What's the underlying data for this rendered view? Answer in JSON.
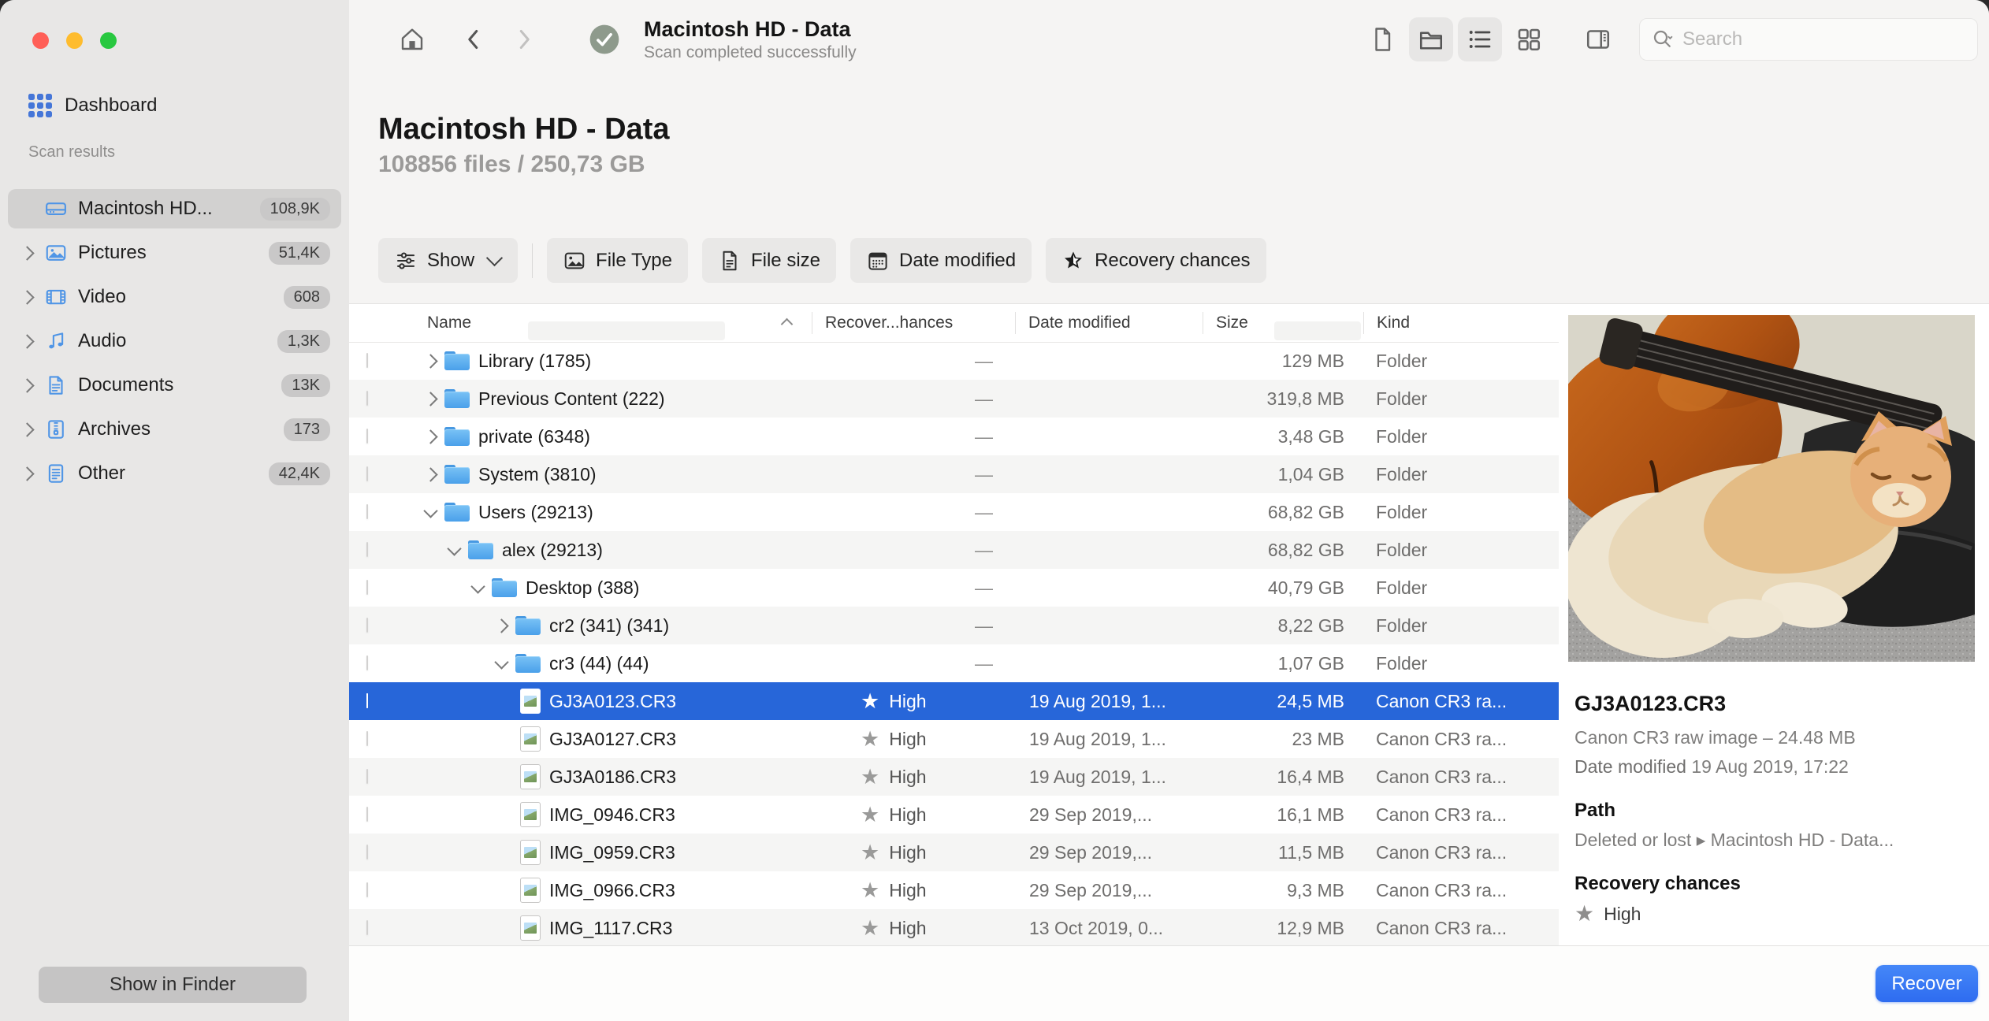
{
  "colors": {
    "accent_blue": "#3478f6",
    "selection_blue": "#2766d9",
    "folder_blue": "#4aa0ea",
    "sidebar_bg": "#e8e7e6",
    "badge_gray": "#c9c8c8",
    "traffic_red": "#ff5f57",
    "traffic_yellow": "#febc2e",
    "traffic_green": "#28c840",
    "scan_badge_green_gray": "#8e9a8c"
  },
  "icons": {
    "star_glyph": "★",
    "dash_glyph": "—"
  },
  "sidebar": {
    "dashboard_label": "Dashboard",
    "section_label": "Scan results",
    "items": [
      {
        "label": "Macintosh HD...",
        "badge": "108,9K",
        "icon": "drive",
        "selected": true,
        "chevron": false
      },
      {
        "label": "Pictures",
        "badge": "51,4K",
        "icon": "pictures",
        "selected": false,
        "chevron": true
      },
      {
        "label": "Video",
        "badge": "608",
        "icon": "video",
        "selected": false,
        "chevron": true
      },
      {
        "label": "Audio",
        "badge": "1,3K",
        "icon": "audio",
        "selected": false,
        "chevron": true
      },
      {
        "label": "Documents",
        "badge": "13K",
        "icon": "documents",
        "selected": false,
        "chevron": true
      },
      {
        "label": "Archives",
        "badge": "173",
        "icon": "archives",
        "selected": false,
        "chevron": true
      },
      {
        "label": "Other",
        "badge": "42,4K",
        "icon": "other",
        "selected": false,
        "chevron": true
      }
    ],
    "show_in_finder_label": "Show in Finder"
  },
  "toolbar": {
    "title": "Macintosh HD - Data",
    "subtitle": "Scan completed successfully",
    "search_placeholder": "Search"
  },
  "header": {
    "title": "Macintosh HD - Data",
    "stats": "108856 files / 250,73 GB"
  },
  "filters": {
    "show_label": "Show",
    "file_type_label": "File Type",
    "file_size_label": "File size",
    "date_modified_label": "Date modified",
    "recovery_chances_label": "Recovery chances"
  },
  "table": {
    "columns": {
      "name": "Name",
      "recovery": "Recover...hances",
      "date": "Date modified",
      "size": "Size",
      "kind": "Kind"
    },
    "rows": [
      {
        "type": "folder",
        "level": 1,
        "expanded": "right",
        "name": "Library (1785)",
        "recovery": "—",
        "date": "",
        "size": "129 MB",
        "kind": "Folder",
        "selected": false
      },
      {
        "type": "folder",
        "level": 1,
        "expanded": "right",
        "name": "Previous Content (222)",
        "recovery": "—",
        "date": "",
        "size": "319,8 MB",
        "kind": "Folder",
        "selected": false
      },
      {
        "type": "folder",
        "level": 1,
        "expanded": "right",
        "name": "private (6348)",
        "recovery": "—",
        "date": "",
        "size": "3,48 GB",
        "kind": "Folder",
        "selected": false
      },
      {
        "type": "folder",
        "level": 1,
        "expanded": "right",
        "name": "System (3810)",
        "recovery": "—",
        "date": "",
        "size": "1,04 GB",
        "kind": "Folder",
        "selected": false
      },
      {
        "type": "folder",
        "level": 1,
        "expanded": "down",
        "name": "Users (29213)",
        "recovery": "—",
        "date": "",
        "size": "68,82 GB",
        "kind": "Folder",
        "selected": false
      },
      {
        "type": "folder",
        "level": 2,
        "expanded": "down",
        "name": "alex (29213)",
        "recovery": "—",
        "date": "",
        "size": "68,82 GB",
        "kind": "Folder",
        "selected": false
      },
      {
        "type": "folder",
        "level": 3,
        "expanded": "down",
        "name": "Desktop (388)",
        "recovery": "—",
        "date": "",
        "size": "40,79 GB",
        "kind": "Folder",
        "selected": false
      },
      {
        "type": "folder",
        "level": 4,
        "expanded": "right",
        "name": "cr2 (341) (341)",
        "recovery": "—",
        "date": "",
        "size": "8,22 GB",
        "kind": "Folder",
        "selected": false
      },
      {
        "type": "folder",
        "level": 4,
        "expanded": "down",
        "name": "cr3 (44) (44)",
        "recovery": "—",
        "date": "",
        "size": "1,07 GB",
        "kind": "Folder",
        "selected": false
      },
      {
        "type": "file",
        "level": 5,
        "expanded": null,
        "name": "GJ3A0123.CR3",
        "recovery": "High",
        "date": "19 Aug 2019, 1...",
        "size": "24,5 MB",
        "kind": "Canon CR3 ra...",
        "selected": true
      },
      {
        "type": "file",
        "level": 5,
        "expanded": null,
        "name": "GJ3A0127.CR3",
        "recovery": "High",
        "date": "19 Aug 2019, 1...",
        "size": "23 MB",
        "kind": "Canon CR3 ra...",
        "selected": false
      },
      {
        "type": "file",
        "level": 5,
        "expanded": null,
        "name": "GJ3A0186.CR3",
        "recovery": "High",
        "date": "19 Aug 2019, 1...",
        "size": "16,4 MB",
        "kind": "Canon CR3 ra...",
        "selected": false
      },
      {
        "type": "file",
        "level": 5,
        "expanded": null,
        "name": "IMG_0946.CR3",
        "recovery": "High",
        "date": "29 Sep 2019,...",
        "size": "16,1 MB",
        "kind": "Canon CR3 ra...",
        "selected": false
      },
      {
        "type": "file",
        "level": 5,
        "expanded": null,
        "name": "IMG_0959.CR3",
        "recovery": "High",
        "date": "29 Sep 2019,...",
        "size": "11,5 MB",
        "kind": "Canon CR3 ra...",
        "selected": false
      },
      {
        "type": "file",
        "level": 5,
        "expanded": null,
        "name": "IMG_0966.CR3",
        "recovery": "High",
        "date": "29 Sep 2019,...",
        "size": "9,3 MB",
        "kind": "Canon CR3 ra...",
        "selected": false
      },
      {
        "type": "file",
        "level": 5,
        "expanded": null,
        "name": "IMG_1117.CR3",
        "recovery": "High",
        "date": "13 Oct 2019, 0...",
        "size": "12,9 MB",
        "kind": "Canon CR3 ra...",
        "selected": false
      }
    ]
  },
  "preview": {
    "filename": "GJ3A0123.CR3",
    "fileinfo": "Canon CR3 raw image – 24.48 MB",
    "date_label": "Date modified",
    "date_value": "19 Aug 2019, 17:22",
    "path_label": "Path",
    "path_value": "Deleted or lost ▸ Macintosh HD - Data...",
    "recovery_label": "Recovery chances",
    "recovery_value": "High"
  },
  "footer": {
    "recover_label": "Recover"
  }
}
